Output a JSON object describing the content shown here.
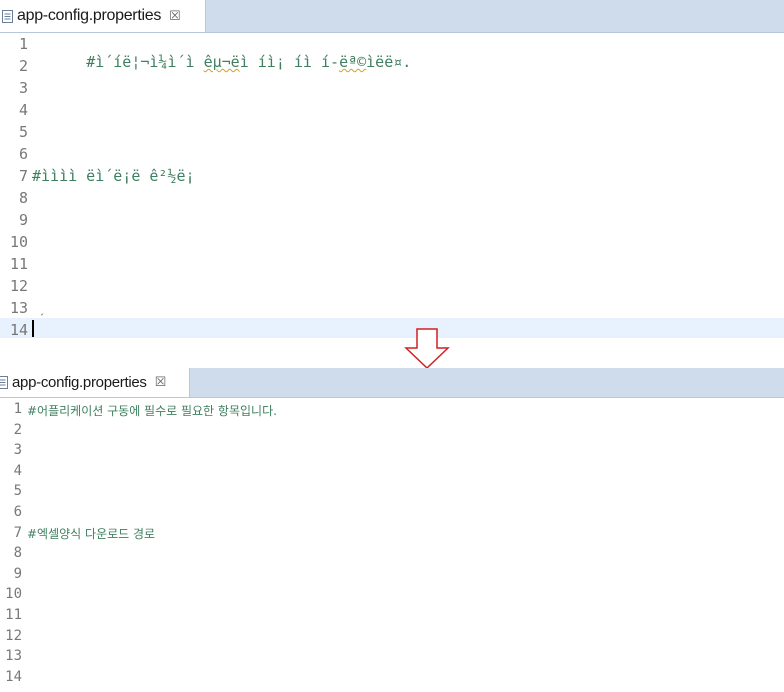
{
  "top_editor": {
    "tab_title": "app-config.properties",
    "close_glyph": "☒",
    "line_numbers": [
      "1",
      "2",
      "3",
      "4",
      "5",
      "6",
      "7",
      "8",
      "9",
      "10",
      "11",
      "12",
      "13",
      "14"
    ],
    "line1_code_pre": "#ì´íë¦¬ì¼ì´ì ",
    "line1_code_squiggle1": "êµ¬ë",
    "line1_code_mid": "ì íì¡ íì í-",
    "line1_code_squiggle2": "ëª©",
    "line1_code_post": "ìëë¤.",
    "line7_code": "#ìììì ëì´ë¡ë ê²½ë¡",
    "line13_marker": "ˊ"
  },
  "bottom_editor": {
    "tab_title": "app-config.properties",
    "close_glyph": "☒",
    "line_numbers": [
      "1",
      "2",
      "3",
      "4",
      "5",
      "6",
      "7",
      "8",
      "9",
      "10",
      "11",
      "12",
      "13",
      "14"
    ],
    "line1_code": "#어플리케이션 구동에 필수로 필요한 항목입니다.",
    "line7_code": "#엑셀양식 다운로드 경로"
  },
  "colors": {
    "tabbar_bg": "#cfdcec",
    "comment_green": "#3f7f5f",
    "line_number_gray": "#787878",
    "current_line_bg": "#e8f2fe",
    "arrow_stroke": "#d02020"
  },
  "icons": {
    "file": "properties-file-icon",
    "close": "close-tab-icon",
    "arrow": "down-arrow-icon"
  }
}
